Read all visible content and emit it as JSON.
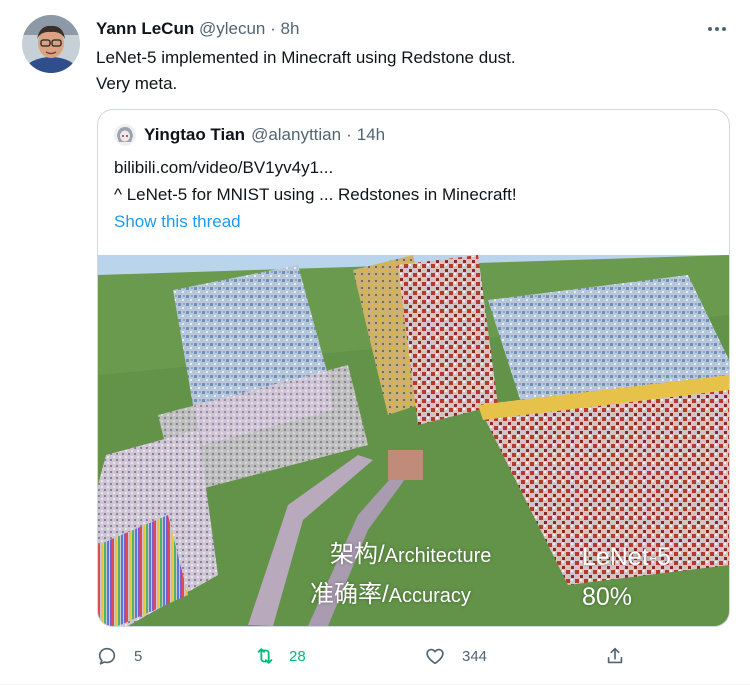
{
  "tweet": {
    "author_name": "Yann LeCun",
    "author_handle": "@ylecun",
    "separator": "·",
    "time": "8h",
    "text_line1": "LeNet-5 implemented in Minecraft using Redstone dust.",
    "text_line2": "Very meta."
  },
  "quote": {
    "author_name": "Yingtao Tian",
    "author_handle": "@alanyttian",
    "separator": "·",
    "time": "14h",
    "line1": "bilibili.com/video/BV1yv4y1...",
    "line2": "^ LeNet-5 for MNIST using ... Redstones in Minecraft!",
    "show_thread": "Show this thread"
  },
  "media_overlay": {
    "arch_cn": "架构",
    "slash1": "/",
    "arch_en": "Architecture",
    "acc_cn": "准确率",
    "slash2": "/",
    "acc_en": "Accuracy",
    "model": "LeNet-5",
    "accuracy": "80%"
  },
  "actions": {
    "reply_count": "5",
    "retweet_count": "28",
    "like_count": "344"
  },
  "colors": {
    "accent": "#1d9bf0",
    "retweet_green": "#00ba7c",
    "muted": "#536471"
  }
}
